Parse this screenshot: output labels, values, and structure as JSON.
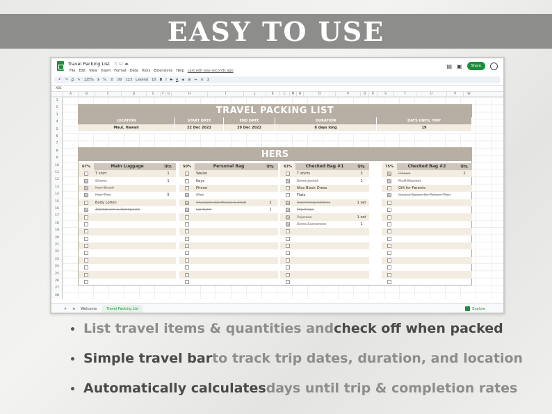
{
  "banner": {
    "text": "EASY TO USE"
  },
  "sheet": {
    "doc_title": "Travel Packing List",
    "menu": [
      "File",
      "Edit",
      "View",
      "Insert",
      "Format",
      "Data",
      "Tools",
      "Extensions",
      "Help"
    ],
    "last_edit": "Last edit was seconds ago",
    "share_label": "Share",
    "toolbar": {
      "zoom": "125%",
      "font": "Lexend",
      "size": "10",
      "currency": "$",
      "percent": "%",
      "dec": ".0",
      "dec2": ".00",
      "fmt": "123"
    },
    "cell_ref": "X81",
    "columns": [
      "A",
      "B",
      "C",
      "D",
      "E",
      "F",
      "G",
      "H",
      "I",
      "J",
      "K",
      "L",
      "M",
      "N",
      "O",
      "P",
      "Q",
      "R",
      "S",
      "T",
      "U",
      "V",
      "W",
      "X"
    ],
    "rows": [
      "1",
      "2",
      "3",
      "4",
      "5",
      "6",
      "7",
      "8",
      "9",
      "10",
      "11",
      "12",
      "13",
      "14",
      "15",
      "16",
      "17",
      "18",
      "19",
      "20",
      "21",
      "22",
      "23",
      "24",
      "25",
      "26",
      "27",
      "28"
    ],
    "tabs": [
      "Welcome",
      "Travel Packing List"
    ],
    "explore_label": "Explore"
  },
  "travel": {
    "title": "TRAVEL PACKING LIST",
    "labels": [
      "LOCATION",
      "START DATE",
      "END DATE",
      "DURATION",
      "DAYS UNTIL TRIP"
    ],
    "values": [
      "Maui, Hawaii",
      "22 Dec 2022",
      "29 Dec 2022",
      "8 days long",
      "19"
    ]
  },
  "hers": {
    "title": "HERS",
    "lists": [
      {
        "pct": "67%",
        "name": "Main Luggage",
        "qty": "Qty.",
        "items": [
          {
            "t": "T shirt",
            "q": "1",
            "d": false
          },
          {
            "t": "Shorts",
            "q": "1",
            "d": true
          },
          {
            "t": "Hair Brush",
            "q": "",
            "d": true
          },
          {
            "t": "Hair Ties",
            "q": "5",
            "d": true
          },
          {
            "t": "Body Lotion",
            "q": "",
            "d": false
          },
          {
            "t": "Toothbrush & Toothpaste",
            "q": "",
            "d": true
          }
        ]
      },
      {
        "pct": "50%",
        "name": "Personal Bag",
        "qty": "Qty.",
        "items": [
          {
            "t": "Wallet",
            "q": "",
            "d": false
          },
          {
            "t": "Keys",
            "q": "",
            "d": false
          },
          {
            "t": "Phone",
            "q": "",
            "d": false
          },
          {
            "t": "iPad",
            "q": "",
            "d": true
          },
          {
            "t": "Chargers (for Phone & iPad)",
            "q": "2",
            "d": true
          },
          {
            "t": "Lip Balm",
            "q": "1",
            "d": true
          }
        ]
      },
      {
        "pct": "63%",
        "name": "Checked Bag #1",
        "qty": "Qty.",
        "items": [
          {
            "t": "T shirts",
            "q": "3",
            "d": false
          },
          {
            "t": "Extra Jacket",
            "q": "1",
            "d": true
          },
          {
            "t": "Nice Black Dress",
            "q": "",
            "d": false
          },
          {
            "t": "Flats",
            "q": "",
            "d": false
          },
          {
            "t": "Swimming Clothes",
            "q": "1 set",
            "d": true
          },
          {
            "t": "Flip Flops",
            "q": "",
            "d": true
          },
          {
            "t": "Pajamas",
            "q": "1 set",
            "d": true
          },
          {
            "t": "Extra Sunscreen",
            "q": "1",
            "d": true
          }
        ]
      },
      {
        "pct": "75%",
        "name": "Checked Bag #2",
        "qty": "Qty.",
        "items": [
          {
            "t": "Pillows",
            "q": "2",
            "d": true
          },
          {
            "t": "Fluff Blanket",
            "q": "",
            "d": true
          },
          {
            "t": "Gift for Parents",
            "q": "",
            "d": false
          },
          {
            "t": "(Leave Space for Return Trip)",
            "q": "",
            "d": true
          }
        ]
      }
    ]
  },
  "bullets": [
    {
      "a": "List travel items & quantities and ",
      "b": "check off when packed"
    },
    {
      "a": "Simple travel bar",
      "b": " to track trip dates, duration, and location"
    },
    {
      "a": "Automatically calculates",
      "b": " days until trip & completion rates"
    }
  ]
}
